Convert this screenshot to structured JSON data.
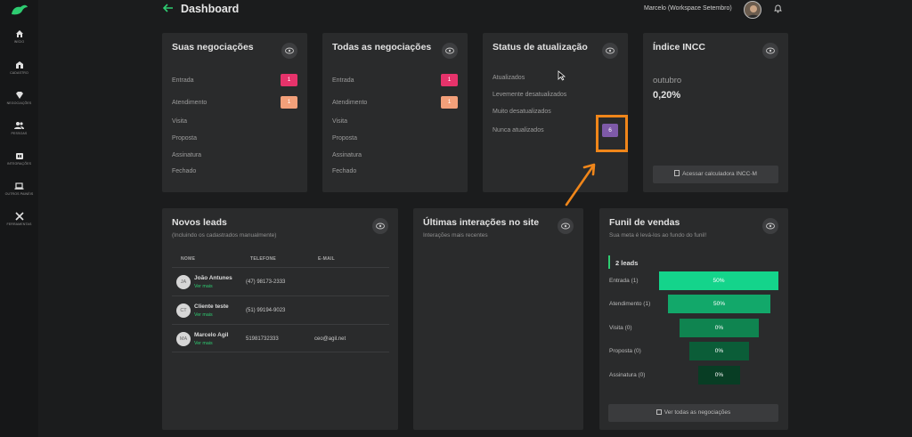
{
  "colors": {
    "accent": "#2ecc71",
    "highlight": "#f0861a",
    "badge_pink": "#e6336b",
    "badge_peach": "#f3a07a",
    "badge_purple": "#7e5aa8"
  },
  "sidebar": {
    "items": [
      {
        "label": "INÍCIO",
        "icon": "home-icon"
      },
      {
        "label": "CADASTRO",
        "icon": "building-icon"
      },
      {
        "label": "NEGOCIAÇÕES",
        "icon": "diamond-icon"
      },
      {
        "label": "PESSOAS",
        "icon": "people-icon"
      },
      {
        "label": "INTEGRAÇÕES",
        "icon": "integration-icon"
      },
      {
        "label": "OUTROS PAINÉIS",
        "icon": "laptop-icon"
      },
      {
        "label": "FERRAMENTAS",
        "icon": "tools-icon"
      }
    ]
  },
  "header": {
    "title": "Dashboard",
    "user": "Marcelo (Workspace Setembro)"
  },
  "suas": {
    "title": "Suas negociações",
    "rows": [
      {
        "label": "Entrada",
        "count": "1"
      },
      {
        "label": "Atendimento",
        "count": "1"
      },
      {
        "label": "Visita"
      },
      {
        "label": "Proposta"
      },
      {
        "label": "Assinatura"
      },
      {
        "label": "Fechado"
      }
    ]
  },
  "todas": {
    "title": "Todas as negociações",
    "rows": [
      {
        "label": "Entrada",
        "count": "1"
      },
      {
        "label": "Atendimento",
        "count": "1"
      },
      {
        "label": "Visita"
      },
      {
        "label": "Proposta"
      },
      {
        "label": "Assinatura"
      },
      {
        "label": "Fechado"
      }
    ]
  },
  "status": {
    "title": "Status de atualização",
    "rows": [
      {
        "label": "Atualizados"
      },
      {
        "label": "Levemente desatualizados"
      },
      {
        "label": "Muito desatualizados"
      },
      {
        "label": "Nunca atualizados",
        "count": "6"
      }
    ]
  },
  "incc": {
    "title": "Índice INCC",
    "month": "outubro",
    "value": "0,20%",
    "button": "Acessar calculadora INCC-M"
  },
  "leads": {
    "title": "Novos leads",
    "subtitle": "(Incluindo os cadastrados manualmente)",
    "columns": [
      "NOME",
      "TELEFONE",
      "E-MAIL"
    ],
    "rows": [
      {
        "initials": "JA",
        "name": "João Antunes",
        "link": "Ver mais",
        "phone": "(47) 98173-2333",
        "email": ""
      },
      {
        "initials": "CT",
        "name": "Cliente teste",
        "link": "Ver mais",
        "phone": "(51) 99194-9023",
        "email": ""
      },
      {
        "initials": "MA",
        "name": "Marcelo Agil",
        "link": "Ver mais",
        "phone": "51981732333",
        "email": "ceo@agil.net"
      }
    ]
  },
  "interacoes": {
    "title": "Últimas interações no site",
    "subtitle": "Interações mais recentes"
  },
  "funil": {
    "title": "Funil de vendas",
    "subtitle": "Sua meta é levá-los ao fundo do funil!",
    "count_label": "2 leads",
    "button": "Ver todas as negociações",
    "stages": [
      {
        "label": "Entrada (1)",
        "value": "50%",
        "fill": 0.5
      },
      {
        "label": "Atendimento (1)",
        "value": "50%",
        "fill": 0.5
      },
      {
        "label": "Visita (0)",
        "value": "0%",
        "fill": 0
      },
      {
        "label": "Proposta (0)",
        "value": "0%",
        "fill": 0
      },
      {
        "label": "Assinatura (0)",
        "value": "0%",
        "fill": 0
      }
    ]
  }
}
